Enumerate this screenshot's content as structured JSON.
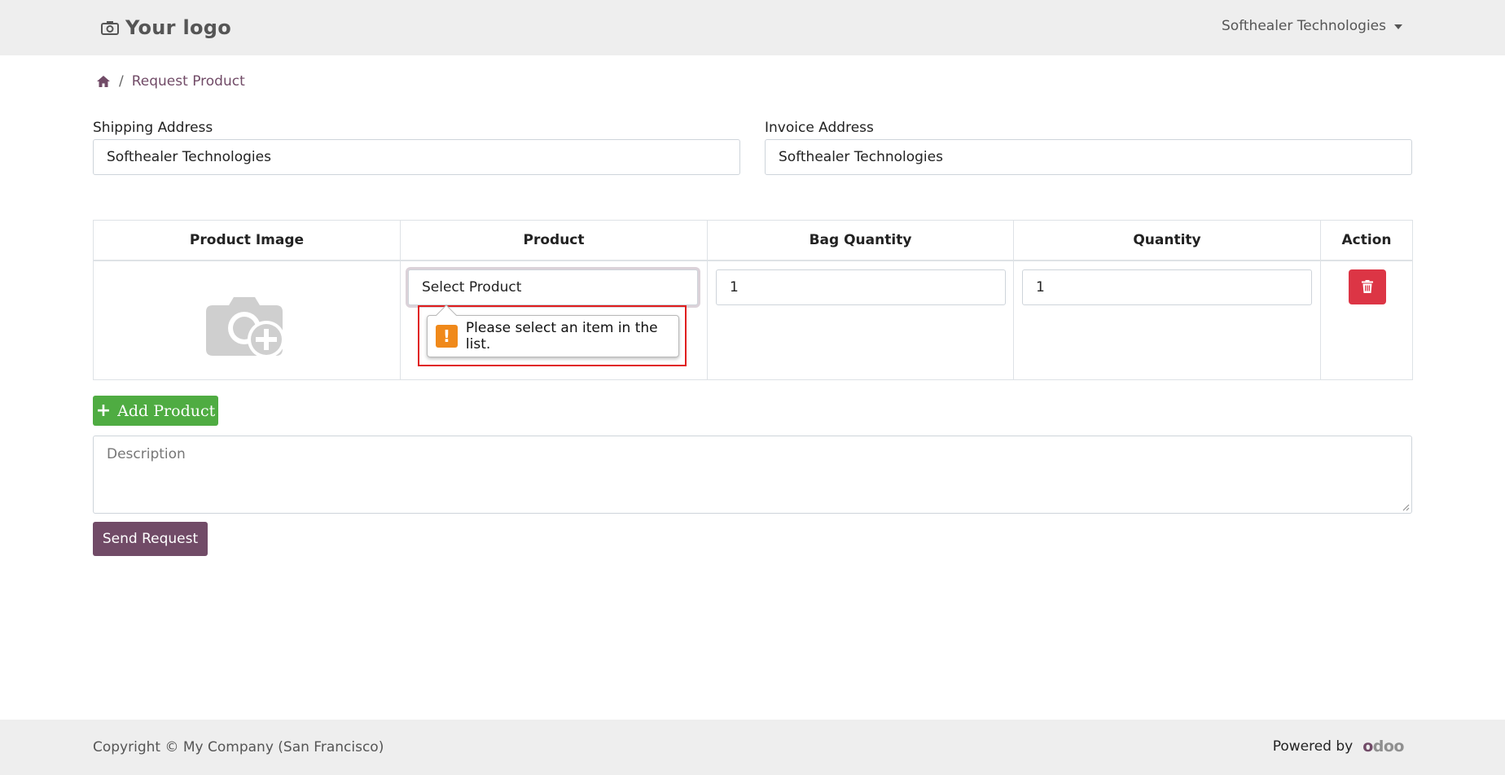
{
  "header": {
    "logo_text": "Your logo",
    "user_name": "Softhealer Technologies"
  },
  "breadcrumb": {
    "separator": "/",
    "current": "Request Product"
  },
  "shipping": {
    "label": "Shipping Address",
    "value": "Softhealer Technologies"
  },
  "invoice": {
    "label": "Invoice Address",
    "value": "Softhealer Technologies"
  },
  "table": {
    "headers": [
      "Product Image",
      "Product",
      "Bag Quantity",
      "Quantity",
      "Action"
    ],
    "row": {
      "product_placeholder": "Select Product",
      "bag_quantity": "1",
      "quantity": "1"
    }
  },
  "validation": {
    "message": "Please select an item in the list.",
    "icon": "!"
  },
  "add_product_label": "Add Product",
  "description_placeholder": "Description",
  "send_request_label": "Send Request",
  "footer": {
    "copyright": "Copyright © My Company (San Francisco)",
    "powered_by": "Powered by",
    "brand": "odoo"
  },
  "colors": {
    "primary": "#714B67",
    "success": "#4fac42",
    "danger": "#dc3545",
    "warning": "#f0891a",
    "highlight": "#e01e1e"
  }
}
